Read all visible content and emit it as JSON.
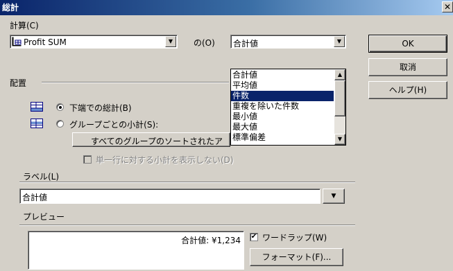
{
  "window": {
    "title": "総計",
    "close_glyph": "✕"
  },
  "calc": {
    "section_label": "計算(C)",
    "field_value": "Profit SUM",
    "of_label": "の(O)",
    "func_value": "合計値",
    "func_options": [
      "合計値",
      "平均値",
      "件数",
      "重複を除いた件数",
      "最小値",
      "最大値",
      "標準偏差"
    ],
    "func_selected_index": 2
  },
  "placement": {
    "section_label": "配置",
    "option_bottom": "下端での総計(B)",
    "option_group": "グループごとの小計(S):",
    "group_select_value": "すべてのグループのソートされたア",
    "checkbox_label": "単一行に対する小計を表示しない(D)",
    "selected": "bottom"
  },
  "label": {
    "section_label": "ラベル(L)",
    "value": "合計値"
  },
  "preview": {
    "section_label": "プレビュー",
    "text": "合計値: ¥1,234",
    "wordwrap_label": "ワードラップ(W)",
    "wordwrap_checked": true,
    "format_button": "フォーマット(F)..."
  },
  "buttons": {
    "ok": "OK",
    "cancel": "取消",
    "help": "ヘルプ(H)"
  },
  "icons": {
    "field": "field-table-icon",
    "bottom": "grid-bottom-icon",
    "group": "grid-group-icon"
  }
}
